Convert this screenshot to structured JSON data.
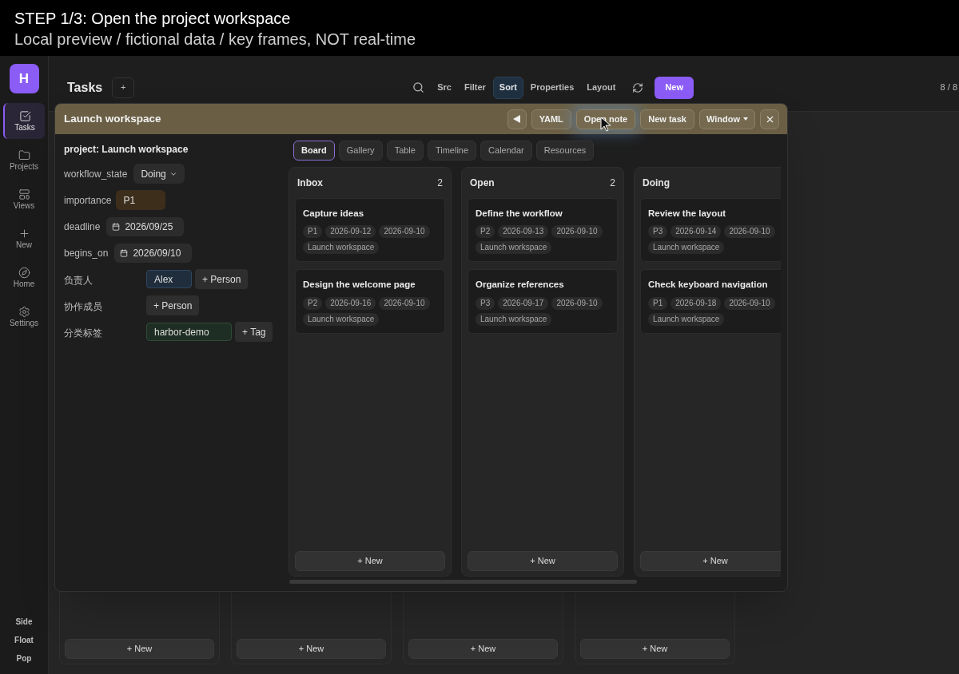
{
  "caption": {
    "title": "STEP 1/3: Open the project workspace",
    "subtitle": "Local preview / fictional data / key frames, NOT real-time"
  },
  "app_logo": "H",
  "sidebar": {
    "items": [
      {
        "label": "Tasks",
        "selected": true
      },
      {
        "label": "Projects",
        "selected": false
      },
      {
        "label": "Views",
        "selected": false
      },
      {
        "label": "New",
        "selected": false
      },
      {
        "label": "Home",
        "selected": false
      },
      {
        "label": "Settings",
        "selected": false
      }
    ],
    "modes": [
      "Side",
      "Float",
      "Pop"
    ]
  },
  "header": {
    "title": "Tasks",
    "add": "+",
    "toolbar": [
      {
        "kind": "search"
      },
      {
        "kind": "text",
        "label": "Src",
        "selected": false
      },
      {
        "kind": "text",
        "label": "Filter",
        "selected": false
      },
      {
        "kind": "text",
        "label": "Sort",
        "selected": true
      },
      {
        "kind": "text",
        "label": "Properties",
        "selected": false
      },
      {
        "kind": "text",
        "label": "Layout",
        "selected": false
      },
      {
        "kind": "refresh"
      },
      {
        "kind": "primary",
        "label": "New"
      }
    ],
    "count": "8 / 8"
  },
  "background_columns": [
    {
      "add": "+ New"
    },
    {
      "add": "+ New"
    },
    {
      "add": "+ New"
    },
    {
      "add": "+ New"
    }
  ],
  "modal": {
    "title": "Launch workspace",
    "buttons": [
      {
        "kind": "back"
      },
      {
        "kind": "text",
        "label": "YAML"
      },
      {
        "kind": "text",
        "label": "Open note",
        "hovered": true
      },
      {
        "kind": "text",
        "label": "New task"
      },
      {
        "kind": "menu",
        "label": "Window"
      },
      {
        "kind": "close"
      }
    ],
    "project_heading": "project: Launch workspace",
    "properties": [
      {
        "kind": "select",
        "label": "workflow_state",
        "value": "Doing"
      },
      {
        "kind": "priority",
        "label": "importance",
        "value": "P1"
      },
      {
        "kind": "date",
        "label": "deadline",
        "value": "2026/09/25"
      },
      {
        "kind": "date",
        "label": "begins_on",
        "value": "2026/09/10"
      },
      {
        "kind": "people",
        "label": "负责人",
        "values": [
          "Alex"
        ],
        "add": "+ Person"
      },
      {
        "kind": "people",
        "label": "协作成员",
        "add": "+ Person"
      },
      {
        "kind": "tags",
        "label": "分类标签",
        "values": [
          "harbor-demo"
        ],
        "add": "+ Tag"
      }
    ],
    "tabs": [
      {
        "label": "Board",
        "selected": true
      },
      {
        "label": "Gallery",
        "selected": false
      },
      {
        "label": "Table",
        "selected": false
      },
      {
        "label": "Timeline",
        "selected": false
      },
      {
        "label": "Calendar",
        "selected": false
      },
      {
        "label": "Resources",
        "selected": false
      }
    ],
    "columns": [
      {
        "name": "Inbox",
        "count": "2",
        "add": "+ New",
        "cards": [
          {
            "title": "Capture ideas",
            "tags": [
              "P1",
              "2026-09-12",
              "2026-09-10",
              "Launch workspace"
            ]
          },
          {
            "title": "Design the welcome page",
            "tags": [
              "P2",
              "2026-09-16",
              "2026-09-10",
              "Launch workspace"
            ]
          }
        ]
      },
      {
        "name": "Open",
        "count": "2",
        "add": "+ New",
        "cards": [
          {
            "title": "Define the workflow",
            "tags": [
              "P2",
              "2026-09-13",
              "2026-09-10",
              "Launch workspace"
            ]
          },
          {
            "title": "Organize references",
            "tags": [
              "P3",
              "2026-09-17",
              "2026-09-10",
              "Launch workspace"
            ]
          }
        ]
      },
      {
        "name": "Doing",
        "add": "+ New",
        "cards": [
          {
            "title": "Review the layout",
            "tags": [
              "P3",
              "2026-09-14",
              "2026-09-10",
              "Launch workspace"
            ]
          },
          {
            "title": "Check keyboard navigation",
            "tags": [
              "P1",
              "2026-09-18",
              "2026-09-10",
              "Launch workspace"
            ]
          }
        ]
      }
    ]
  }
}
